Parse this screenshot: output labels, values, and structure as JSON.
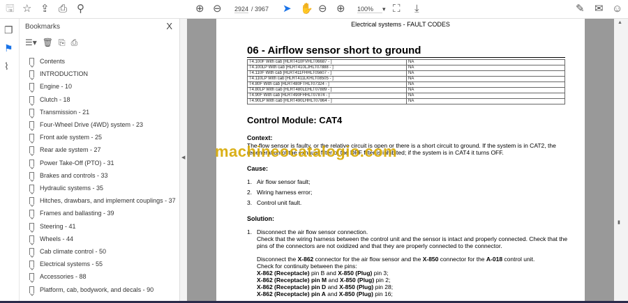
{
  "toolbar": {
    "page_current": "2924",
    "page_total": "/ 3967",
    "zoom": "100%",
    "zoom_arrow": "▾",
    "icons": [
      "save-icon",
      "bookmark-star-icon",
      "upload-icon",
      "print-icon",
      "search-icon",
      "page-up-icon",
      "page-down-icon",
      "select-cursor-icon",
      "hand-icon",
      "zoom-out-icon",
      "zoom-in-icon",
      "fit-page-icon",
      "read-mode-icon",
      "sign-icon",
      "email-icon",
      "account-icon"
    ]
  },
  "bookmarks": {
    "title": "Bookmarks",
    "close": "X",
    "items": [
      "Contents",
      "INTRODUCTION",
      "Engine - 10",
      "Clutch - 18",
      "Transmission - 21",
      "Four-Wheel Drive (4WD) system - 23",
      "Front axle system - 25",
      "Rear axle system - 27",
      "Power Take-Off (PTO) - 31",
      "Brakes and controls - 33",
      "Hydraulic systems - 35",
      "Hitches, drawbars, and implement couplings - 37",
      "Frames and ballasting - 39",
      "Steering - 41",
      "Wheels - 44",
      "Cab climate control - 50",
      "Electrical systems - 55",
      "Accessories - 88",
      "Platform, cab, bodywork, and decals - 90"
    ]
  },
  "document": {
    "header": "Electrical systems - FAULT CODES",
    "title": "06 - Airflow sensor short to ground",
    "table": [
      [
        "T4.100F With cab [HLRT410FVHLT06687 - ]",
        "NA"
      ],
      [
        "T4.100LP With cab [HLRT410LJHLT07888 - ]",
        "NA"
      ],
      [
        "T4.110F With cab [HLRT411FHHLT05607 - ]",
        "NA"
      ],
      [
        "T4.110LP With cab [HLRT411LKHLT08505 - ]",
        "NA"
      ],
      [
        "T4.80F With cab [HLRT480FTHLT07324 - ]",
        "NA"
      ],
      [
        "T4.80LP With cab [HLRT480LEHLT07889 - ]",
        "NA"
      ],
      [
        "T4.90F With cab [HLRT490FHHLT07874 - ]",
        "NA"
      ],
      [
        "T4.90LP With cab [HLRT490LHHLT07864 - ]",
        "NA"
      ]
    ],
    "module": "Control Module:  CAT4",
    "context_label": "Context:",
    "context": "The flow sensor is faulty, or the relative circuit is open or there is a short circuit to ground.  If the system is in CAT2, the regeneration of the exhaust filter of the DPF filter is inhibited; if the system is in CAT4 it turns OFF.",
    "cause_label": "Cause:",
    "causes": [
      "Air flow sensor fault;",
      "Wiring harness error;",
      "Control unit fault."
    ],
    "solution_label": "Solution:",
    "step1": "Disconnect the air flow sensor connection.",
    "step1_detail": "Check that the wiring harness between the control unit and the sensor is intact and properly connected.  Check that the pins of the connectors are not oxidized and that they are properly connected to the connector.",
    "disconnect": [
      "Disconnect the ",
      "X-862",
      " connector for the air flow sensor and the ",
      "X-850",
      " connector for the ",
      "A-018",
      " control unit."
    ],
    "continuity": "Check for continuity between the pins:",
    "pins": [
      [
        "X-862 (Receptacle)",
        " pin B and ",
        "X-850 (Plug)",
        " pin 3;"
      ],
      [
        "X-862 (Receptacle) pin M",
        " and ",
        "X-850 (Plug)",
        " pin 2;"
      ],
      [
        "X-862 (Receptacle) pin D",
        " and ",
        "X-850 (Plug)",
        " pin 28;"
      ],
      [
        "X-862 (Receptacle) pin A",
        " and ",
        "X-850 (Plug)",
        " pin 16;"
      ]
    ]
  },
  "watermark": "machineocatalogio.com"
}
